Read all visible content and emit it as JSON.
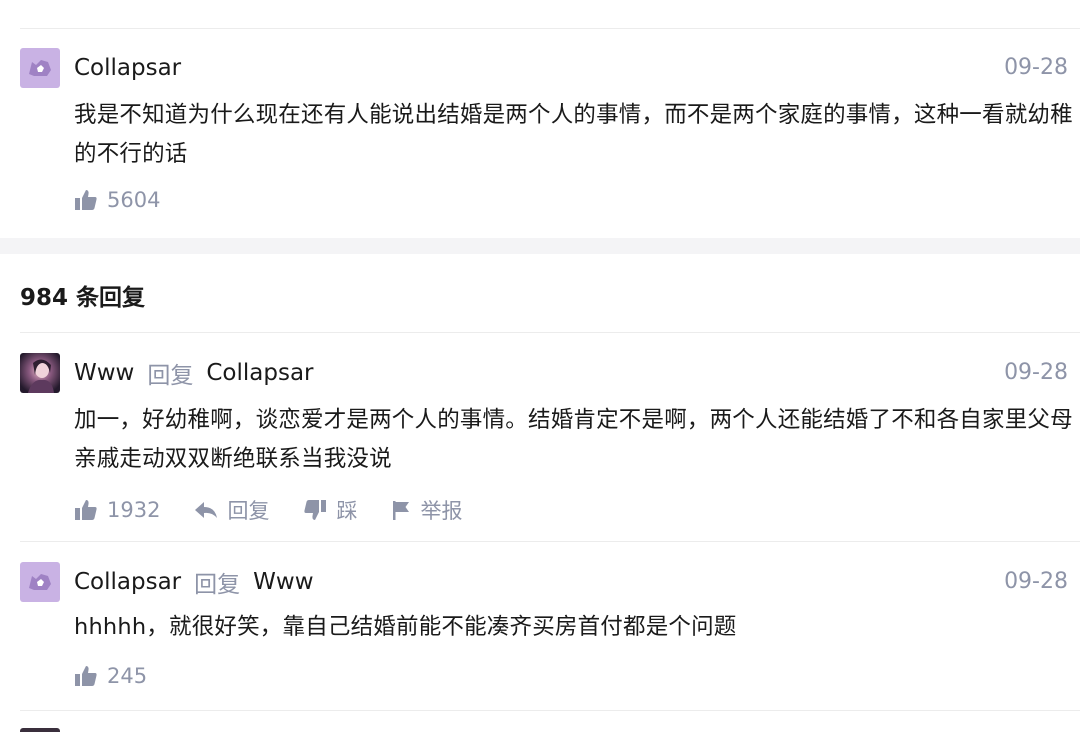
{
  "colors": {
    "text": "#1a1a1a",
    "muted": "#8e94a8",
    "divider": "#ececec",
    "band": "#f4f4f6",
    "avatar_purple": "#c9b2e4"
  },
  "top_comment": {
    "author": "Collapsar",
    "date": "09-28",
    "text": "我是不知道为什么现在还有人能说出结婚是两个人的事情，而不是两个家庭的事情，这种一看就幼稚的不行的话",
    "likes": "5604"
  },
  "replies_header": {
    "count": "984",
    "label": "条回复"
  },
  "replies": [
    {
      "author": "Www",
      "reply_word": "回复",
      "reply_to": "Collapsar",
      "date": "09-28",
      "text": "加一，好幼稚啊，谈恋爱才是两个人的事情。结婚肯定不是啊，两个人还能结婚了不和各自家里父母亲戚走动双双断绝联系当我没说",
      "likes": "1932",
      "reply_label": "回复",
      "dislike_label": "踩",
      "report_label": "举报"
    },
    {
      "author": "Collapsar",
      "reply_word": "回复",
      "reply_to": "Www",
      "date": "09-28",
      "text": "hhhhh，就很好笑，靠自己结婚前能不能凑齐买房首付都是个问题",
      "likes": "245"
    }
  ],
  "icons": [
    "thumbs-up-icon",
    "reply-arrow-icon",
    "thumbs-down-icon",
    "flag-icon"
  ]
}
